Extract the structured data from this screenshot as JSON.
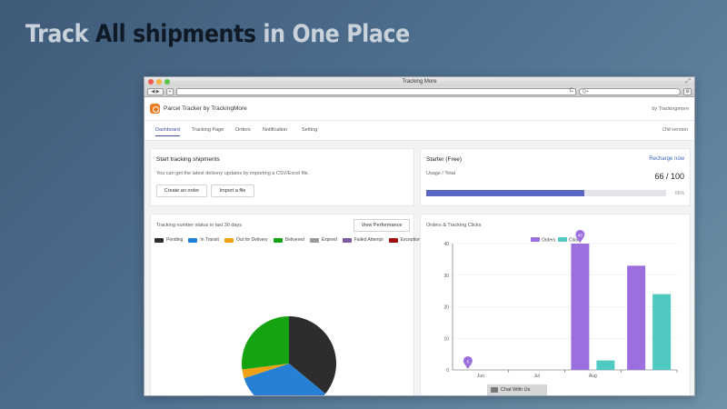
{
  "headline": {
    "part1": "Track ",
    "part2": "All shipments",
    "part3": " in One Place"
  },
  "browser": {
    "title": "Tracking More",
    "back_label": "◀ ▶",
    "new_tab": "+",
    "reload": "C",
    "search_placeholder": "Q+"
  },
  "app": {
    "name": "Parcel Tracker by TrackingMore",
    "by": "by Trackingmore"
  },
  "tabs": [
    "Dashboard",
    "Tracking Page",
    "Orders",
    "Notification",
    "Setting"
  ],
  "old_version": "Old version",
  "start_card": {
    "title": "Start tracking shipments",
    "subtitle": "You can get the latest delivery updates by importing a CSV/Excel file.",
    "create_btn": "Create an order",
    "import_btn": "Import a file"
  },
  "plan_card": {
    "title": "Starter (Free)",
    "recharge": "Recharge now",
    "usage_label": "Usage / Total",
    "usage_value": "66 / 100",
    "usage_fraction": 0.66,
    "usage_pct_label": "66%"
  },
  "status_card": {
    "title": "Tracking number status in last 30 days",
    "button": "View Performance"
  },
  "clicks_card": {
    "title": "Orders & Tracking Clicks"
  },
  "chat": {
    "label": "Chat With Us"
  },
  "colors": {
    "accent": "#3b4fa3",
    "progress": "#5a68c4",
    "orders": "#9c6fde",
    "clicks": "#4fc9c1"
  },
  "chart_data": [
    {
      "type": "pie",
      "legend": [
        "Pending",
        "In Transit",
        "Out for Delivery",
        "Delivered",
        "Expired",
        "Failed Attempt",
        "Exception"
      ],
      "legend_colors": [
        "#2d2d2d",
        "#1e7fd6",
        "#f0a116",
        "#15a312",
        "#9a9a9a",
        "#7a5ba0",
        "#a01010"
      ],
      "slices": [
        {
          "label": "Pending",
          "value": 36,
          "color": "#2d2d2d"
        },
        {
          "label": "In Transit",
          "value": 34,
          "color": "#2680d3"
        },
        {
          "label": "Out for Delivery",
          "value": 3,
          "color": "#f0a116"
        },
        {
          "label": "Delivered",
          "value": 27,
          "color": "#15a312"
        }
      ]
    },
    {
      "type": "bar",
      "categories": [
        "Jun",
        "Jul",
        "Aug",
        ""
      ],
      "series": [
        {
          "name": "Orders",
          "color": "#9c6fde",
          "values": [
            0,
            0,
            40,
            33
          ]
        },
        {
          "name": "Clicks",
          "color": "#4fc9c1",
          "values": [
            0,
            0,
            3,
            24
          ]
        }
      ],
      "yticks": [
        "0",
        "10",
        "20",
        "30",
        "40"
      ],
      "ylim": [
        0,
        40
      ],
      "markers": [
        {
          "category": 0,
          "value": 0,
          "label": "0"
        },
        {
          "category": 2,
          "value": 40,
          "label": "40"
        }
      ]
    }
  ]
}
